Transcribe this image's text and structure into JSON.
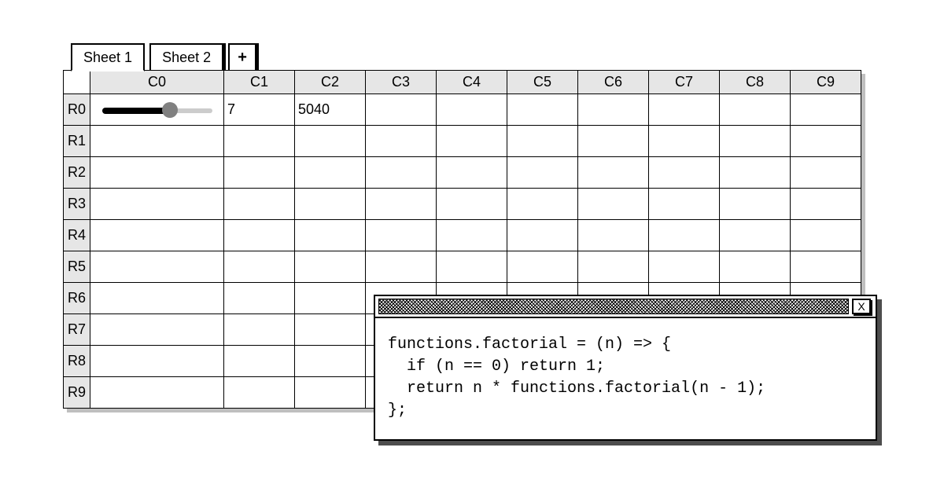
{
  "tabs": {
    "items": [
      {
        "label": "Sheet 1",
        "active": true
      },
      {
        "label": "Sheet 2",
        "active": false
      }
    ],
    "add_label": "+"
  },
  "grid": {
    "col_headers": [
      "C0",
      "C1",
      "C2",
      "C3",
      "C4",
      "C5",
      "C6",
      "C7",
      "C8",
      "C9"
    ],
    "row_headers": [
      "R0",
      "R1",
      "R2",
      "R3",
      "R4",
      "R5",
      "R6",
      "R7",
      "R8",
      "R9"
    ],
    "cells": {
      "R0_C0": {
        "special": "slider",
        "value_percent": 62
      },
      "R0_C1": "7",
      "R0_C2": "5040"
    }
  },
  "panel": {
    "close_label": "X",
    "code": "functions.factorial = (n) => {\n  if (n == 0) return 1;\n  return n * functions.factorial(n - 1);\n};"
  }
}
